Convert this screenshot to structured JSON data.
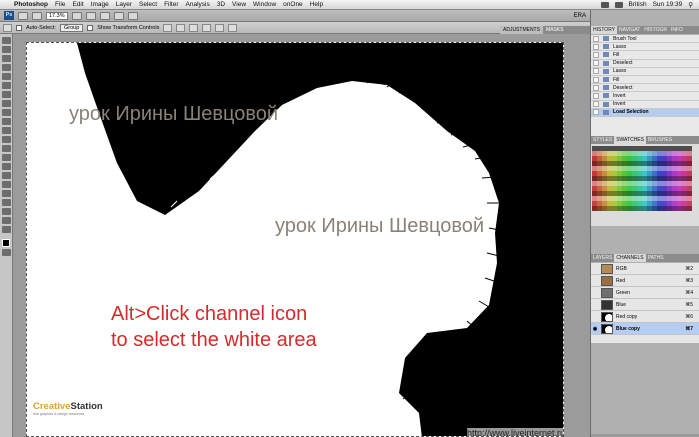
{
  "menubar": {
    "app": "Photoshop",
    "items": [
      "File",
      "Edit",
      "Image",
      "Layer",
      "Select",
      "Filter",
      "Analysis",
      "3D",
      "View",
      "Window",
      "onOne",
      "Help"
    ],
    "language": "British",
    "clock": "Sun 19:39"
  },
  "appbar": {
    "zoom": "17.3%",
    "workspace": "ERA"
  },
  "options": {
    "auto_select_label": "Auto-Select:",
    "auto_select_value": "Group",
    "transform_label": "Show Transform Controls"
  },
  "panels": {
    "adjust_tabs": [
      "ADJUSTMENTS",
      "MASKS"
    ],
    "history_tabs": [
      "HISTORY",
      "NAVIGAT",
      "HISTOGR",
      "INFO"
    ],
    "history_items": [
      {
        "label": "Brush Tool",
        "active": false
      },
      {
        "label": "Lasso",
        "active": false
      },
      {
        "label": "Fill",
        "active": false
      },
      {
        "label": "Deselect",
        "active": false
      },
      {
        "label": "Lasso",
        "active": false
      },
      {
        "label": "Fill",
        "active": false
      },
      {
        "label": "Deselect",
        "active": false
      },
      {
        "label": "Invert",
        "active": false
      },
      {
        "label": "Invert",
        "active": false
      },
      {
        "label": "Load Selection",
        "active": true
      }
    ],
    "style_tabs": [
      "STYLES",
      "SWATCHES",
      "BRUSHES"
    ],
    "layer_tabs": [
      "LAYERS",
      "CHANNELS",
      "PATHS"
    ],
    "channels": [
      {
        "name": "RGB",
        "shortcut": "⌘2",
        "thumb": "color"
      },
      {
        "name": "Red",
        "shortcut": "⌘3",
        "thumb": "color"
      },
      {
        "name": "Green",
        "shortcut": "⌘4",
        "thumb": "color"
      },
      {
        "name": "Blue",
        "shortcut": "⌘5",
        "thumb": "dark"
      },
      {
        "name": "Red copy",
        "shortcut": "⌘6",
        "thumb": "mask"
      },
      {
        "name": "Blue copy",
        "shortcut": "⌘7",
        "thumb": "mask",
        "active": true
      }
    ]
  },
  "canvas": {
    "watermark_1": "урок Ирины Шевцовой",
    "watermark_2": "урок Ирины Шевцовой",
    "callout_line1": "Alt>Click channel icon",
    "callout_line2": "to select the white area",
    "logo_name_a": "Creative",
    "logo_name_b": "Station",
    "logo_sub": "free graphics & design resources",
    "url": "http://www.liveinternet.ru/users/4878954/"
  },
  "colors": {
    "callout": "#d42b2b",
    "watermark": "#8a8278",
    "selection": "#b5cdf0"
  }
}
